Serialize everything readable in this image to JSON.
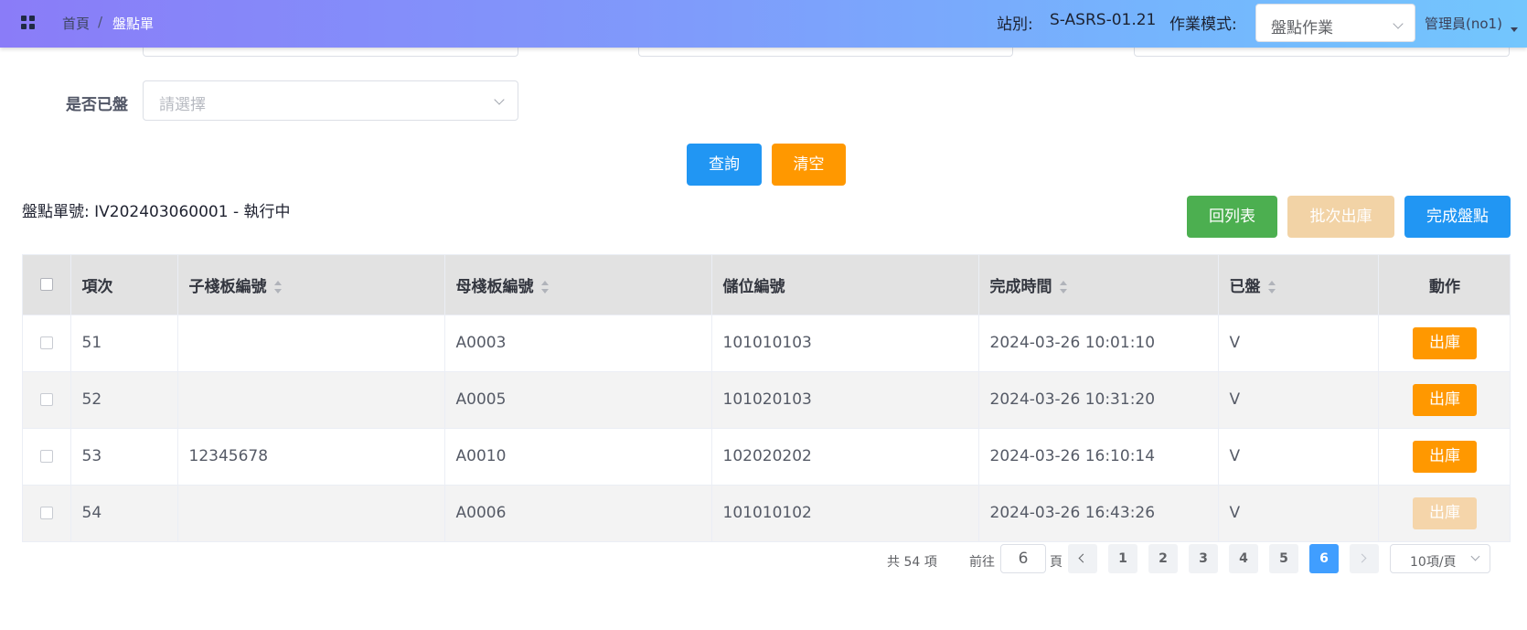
{
  "header": {
    "breadcrumb": [
      "首頁",
      "/",
      "盤點單"
    ],
    "station_label": "站別:",
    "station_value": "S-ASRS-01.21",
    "mode_label": "作業模式:",
    "mode_value": "盤點作業",
    "user": "管理員(no1)"
  },
  "filters": {
    "counted_label": "是否已盤",
    "counted_placeholder": "請選擇"
  },
  "buttons": {
    "query": "查詢",
    "clear": "清空",
    "back": "回列表",
    "batch_out": "批次出庫",
    "finish": "完成盤點"
  },
  "order": {
    "text": "盤點單號:  IV202403060001 - 執行中"
  },
  "table": {
    "headers": [
      "項次",
      "子棧板編號",
      "母棧板編號",
      "儲位編號",
      "完成時間",
      "已盤",
      "動作"
    ],
    "action_label": "出庫",
    "rows": [
      {
        "seq": "51",
        "child": "",
        "parent": "A0003",
        "location": "101010103",
        "time": "2024-03-26 10:01:10",
        "counted": "V"
      },
      {
        "seq": "52",
        "child": "",
        "parent": "A0005",
        "location": "101020103",
        "time": "2024-03-26 10:31:20",
        "counted": "V"
      },
      {
        "seq": "53",
        "child": "12345678",
        "parent": "A0010",
        "location": "102020202",
        "time": "2024-03-26 16:10:14",
        "counted": "V"
      },
      {
        "seq": "54",
        "child": "",
        "parent": "A0006",
        "location": "101010102",
        "time": "2024-03-26 16:43:26",
        "counted": "V"
      }
    ]
  },
  "pagination": {
    "total": "共 54 項",
    "goto_label": "前往",
    "current_page": "6",
    "page_unit": "頁",
    "pages": [
      "1",
      "2",
      "3",
      "4",
      "5",
      "6"
    ],
    "active_page": "6",
    "page_size": "10項/頁"
  },
  "colors": {
    "primary": "#2196f3",
    "warning": "#ff9800",
    "success": "#4caf50"
  }
}
